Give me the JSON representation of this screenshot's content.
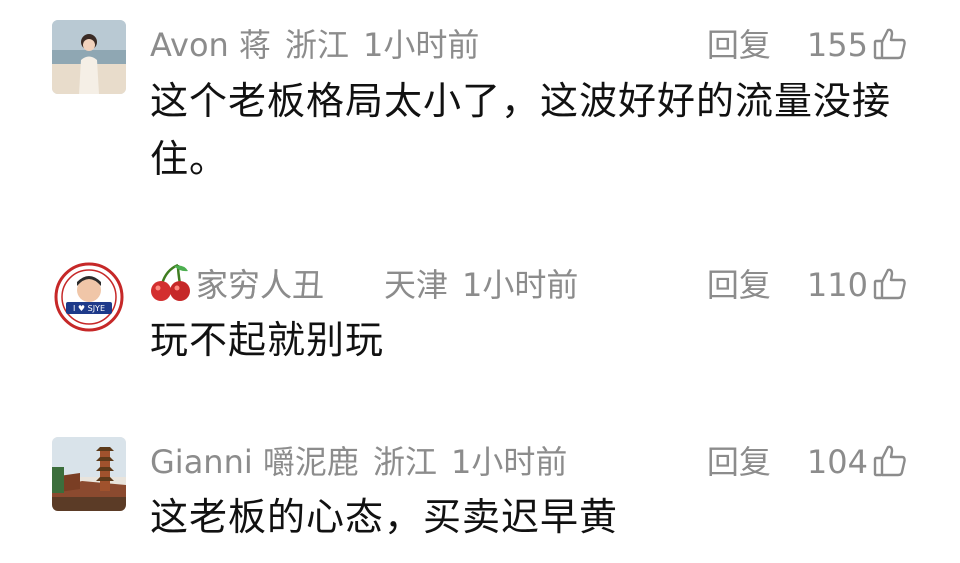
{
  "comments": [
    {
      "user": "Avon 蒋",
      "location": "浙江",
      "time": "1小时前",
      "reply": "回复",
      "likes": "155",
      "text": "这个老板格局太小了，这波好好的流量没接住。",
      "avatar_icon": "person-photo-avatar"
    },
    {
      "user": "家穷人丑",
      "location": "天津",
      "time": "1小时前",
      "reply": "回复",
      "likes": "110",
      "text": "玩不起就别玩",
      "avatar_icon": "circular-badge-avatar",
      "name_emoji": "cherry-icon"
    },
    {
      "user": "Gianni 嚼泥鹿",
      "location": "浙江",
      "time": "1小时前",
      "reply": "回复",
      "likes": "104",
      "text": "这老板的心态，买卖迟早黄",
      "avatar_icon": "pagoda-photo-avatar"
    }
  ],
  "colors": {
    "meta": "#8c8c8c",
    "text": "#111111",
    "background": "#ffffff"
  }
}
